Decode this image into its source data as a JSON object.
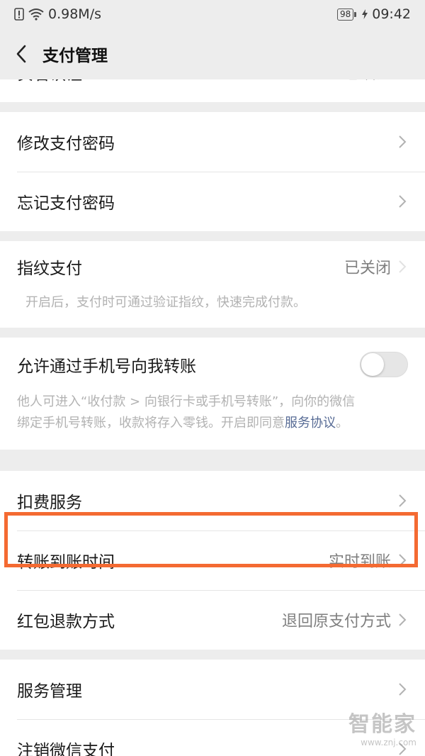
{
  "status": {
    "speed": "0.98M/s",
    "battery": "98",
    "time": "09:42"
  },
  "header": {
    "title": "支付管理"
  },
  "sections": {
    "realname": {
      "label": "实名认证",
      "value": "已认证"
    },
    "modify_password": {
      "label": "修改支付密码"
    },
    "forget_password": {
      "label": "忘记支付密码"
    },
    "fingerprint": {
      "label": "指纹支付",
      "value": "已关闭",
      "desc": "开启后，支付时可通过验证指纹，快速完成付款。"
    },
    "phone_transfer": {
      "label": "允许通过手机号向我转账",
      "desc_line1": "他人可进入“收付款 > 向银行卡或手机号转账”，向你的微信",
      "desc_line2": "绑定手机号转账，收款将存入零钱。开启即同意",
      "link": "服务协议",
      "period": "。"
    },
    "deduction": {
      "label": "扣费服务"
    },
    "transfer_time": {
      "label": "转账到账时间",
      "value": "实时到账"
    },
    "hongbao_refund": {
      "label": "红包退款方式",
      "value": "退回原支付方式"
    },
    "service_manage": {
      "label": "服务管理"
    },
    "cancel_pay": {
      "label": "注销微信支付"
    }
  },
  "watermark": {
    "brand": "智能家",
    "url": "www.znj.com"
  }
}
